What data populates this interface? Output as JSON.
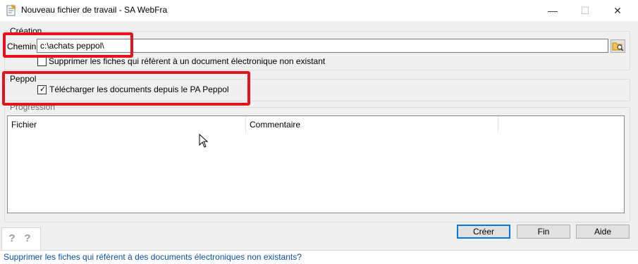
{
  "window": {
    "title": "Nouveau fichier de travail - SA WebFra",
    "minimize_glyph": "—",
    "maximize_glyph": "☐",
    "close_glyph": "✕"
  },
  "creation": {
    "legend": "Création",
    "path_label": "Chemin:",
    "path_value": "c:\\achats peppol\\",
    "delete_checkbox_label": "Supprimer les fiches qui réfèrent à un document électronique non existant",
    "delete_checked": false
  },
  "peppol": {
    "legend": "Peppol",
    "download_checkbox_label": "Télécharger les documents depuis le PA Peppol",
    "download_checked": true
  },
  "progression": {
    "legend": "Progression",
    "columns": [
      "Fichier",
      "Commentaire"
    ],
    "rows": []
  },
  "buttons": {
    "create": "Créer",
    "finish": "Fin",
    "help": "Aide"
  },
  "help_tab": {
    "icons": [
      "help-question-icon",
      "help-question-icon"
    ],
    "glyph": "?"
  },
  "status": {
    "text": "Supprimer les fiches qui réfèrent à des documents électroniques non existants?"
  },
  "colors": {
    "highlight": "#e3141b",
    "status_text": "#0d4fa8",
    "default_button_border": "#0078d7"
  }
}
